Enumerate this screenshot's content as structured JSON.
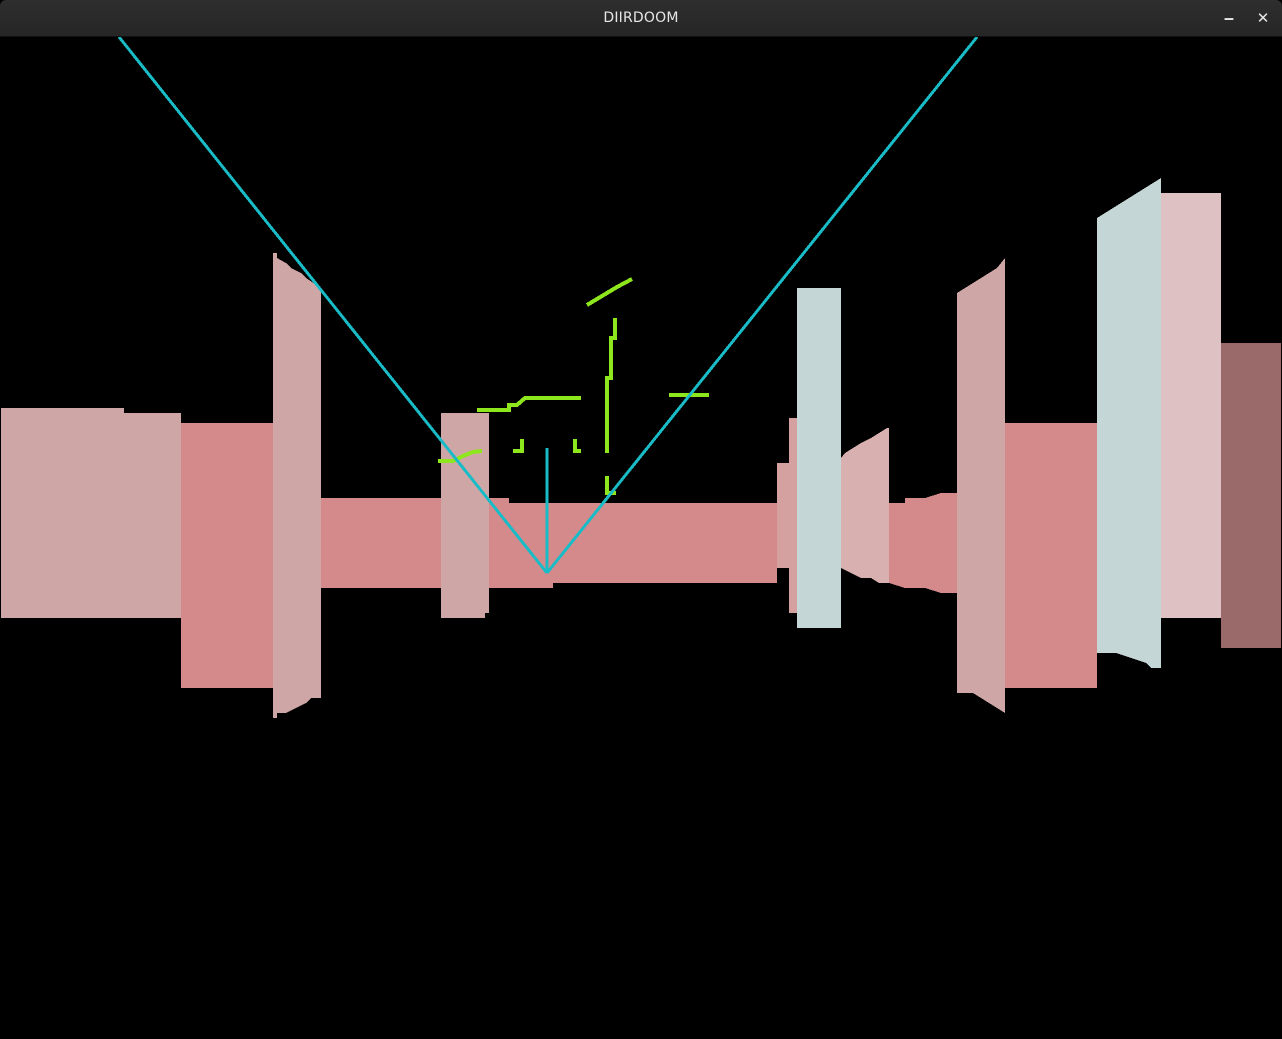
{
  "window": {
    "title": "DIIRDOOM"
  },
  "titlebar": {
    "minimize_label": "‒",
    "close_label": "✕",
    "minimize_icon": "minimize-icon",
    "close_icon": "close-icon"
  },
  "colors": {
    "background": "#000000",
    "titlebar": "#2b2b2b",
    "title_text": "#e6e6e6",
    "wall_pink_light": "#cea6a6",
    "wall_pink_mid": "#d48a8a",
    "wall_pink_far": "#d49494",
    "wall_pale_blue": "#c4d6d6",
    "wall_pale_pink": "#ddc1c3",
    "wall_dark_mauve": "#9a6a6a",
    "fov_lines": "#19bcc6",
    "minimap_lines": "#8ee61c"
  }
}
